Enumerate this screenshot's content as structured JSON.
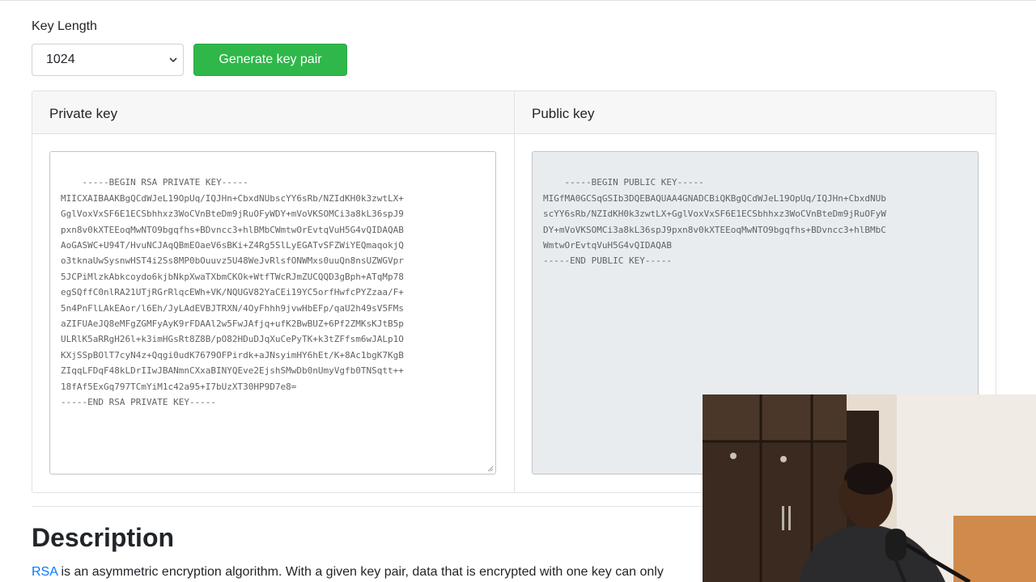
{
  "form": {
    "key_length_label": "Key Length",
    "key_length_value": "1024",
    "generate_button": "Generate key pair"
  },
  "panels": {
    "private_title": "Private key",
    "public_title": "Public key",
    "private_key": "-----BEGIN RSA PRIVATE KEY-----\nMIICXAIBAAKBgQCdWJeL19OpUq/IQJHn+CbxdNUbscYY6sRb/NZIdKH0k3zwtLX+\nGglVoxVxSF6E1ECSbhhxz3WoCVnBteDm9jRuOFyWDY+mVoVKSOMCi3a8kL36spJ9\npxn8v0kXTEEoqMwNTO9bgqfhs+BDvncc3+hlBMbCWmtwOrEvtqVuH5G4vQIDAQAB\nAoGASWC+U94T/HvuNCJAqQBmEOaeV6sBKi+Z4Rg5SlLyEGATvSFZWiYEQmaqokjQ\no3tknaUwSysnwHST4i2Ss8MP0bOuuvz5U48WeJvRlsfONWMxs0uuQn8nsUZWGVpr\n5JCPiMlzkAbkcoydo6kjbNkpXwaTXbmCKOk+WtfTWcRJmZUCQQD3gBph+ATqMp78\negSQffC0nlRA21UTjRGrRlqcEWh+VK/NQUGV82YaCEi19YC5orfHwfcPYZzaa/F+\n5n4PnFlLAkEAor/l6Eh/JyLAdEVBJTRXN/4OyFhhh9jvwHbEFp/qaU2h49sV5FMs\naZIFUAeJQ8eMFgZGMFyAyK9rFDAAl2w5FwJAfjq+ufK2BwBUZ+6Pf2ZMKsKJtB5p\nULRlK5aRRgH26l+k3imHGsRt8Z8B/pO82HDuDJqXuCePyTK+k3tZFfsm6wJALp1O\nKXjSSpBOlT7cyN4z+Qqgi0udK7679OFPirdk+aJNsyimHY6hEt/K+8Ac1bgK7KgB\nZIqqLFDqF48kLDrIIwJBANmnCXxaBINYQEve2EjshSMwDb0nUmyVgfb0TNSqtt++\n18fAf5ExGq797TCmYiM1c42a95+I7bUzXT30HP9D7e8=\n-----END RSA PRIVATE KEY-----",
    "public_key": "-----BEGIN PUBLIC KEY-----\nMIGfMA0GCSqGSIb3DQEBAQUAA4GNADCBiQKBgQCdWJeL19OpUq/IQJHn+CbxdNUb\nscYY6sRb/NZIdKH0k3zwtLX+GglVoxVxSF6E1ECSbhhxz3WoCVnBteDm9jRuOFyW\nDY+mVoVKSOMCi3a8kL36spJ9pxn8v0kXTEEoqMwNTO9bgqfhs+BDvncc3+hlBMbC\nWmtwOrEvtqVuH5G4vQIDAQAB\n-----END PUBLIC KEY-----"
  },
  "description": {
    "title": "Description",
    "link_text": "RSA",
    "text": " is an asymmetric encryption algorithm. With a given key pair, data that is encrypted with one key can only"
  },
  "colors": {
    "button_green": "#2fb74a",
    "link_blue": "#007bff",
    "readonly_bg": "#e9ecef"
  }
}
